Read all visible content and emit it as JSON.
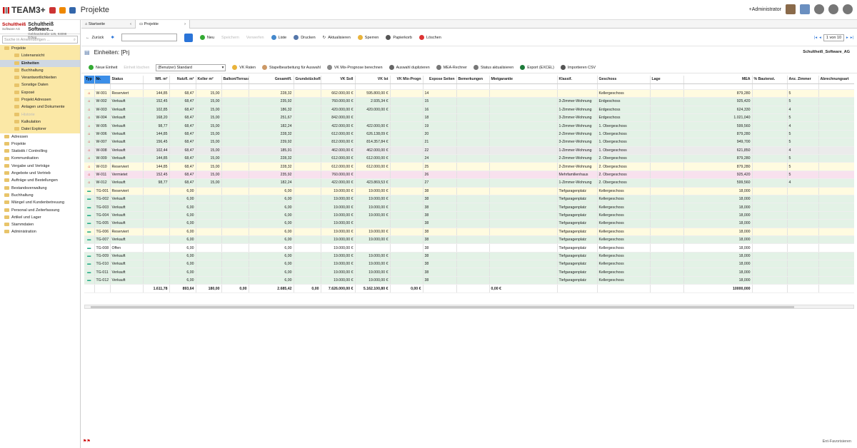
{
  "app": {
    "logo": "TEAM3+",
    "title": "Projekte"
  },
  "topbar": {
    "user": "+Administrator"
  },
  "company": {
    "brand": "Schultheiß",
    "brand_sub": "Software AG",
    "name": "Schultheiß Software...",
    "address": "Gebhardstraße 125, 93098 Erbeg..."
  },
  "search": {
    "placeholder": "Suche in Anwendungen ..."
  },
  "tree": {
    "root": "Projekte",
    "sub": [
      "Listenansicht",
      "Einheiten",
      "Buchhaltung",
      "Verantwortlichkeiten",
      "Sonstige Daten",
      "Exposé",
      "Projekt Adressen",
      "Anlagen und Dokumente",
      "Historie",
      "Kalkulation",
      "Datei Explorer"
    ],
    "modules": [
      "Adressen",
      "Projekte",
      "Statistik / Controlling",
      "Kommunikation",
      "Vergabe und Verträge",
      "Angebote und Vertrieb",
      "Aufträge und Bestellungen",
      "Bestandsverwaltung",
      "Buchhaltung",
      "Mängel und Kundenbetreuung",
      "Personal und Zeiterfassung",
      "Artikel und Lager",
      "Stammdaten",
      "Administration"
    ]
  },
  "tabs": [
    "Startseite",
    "Projekte"
  ],
  "toolbar": {
    "back": "Zurück",
    "new": "Neu",
    "save": "Speichern",
    "discard": "Verwerfen",
    "list": "Liste",
    "print": "Drucken",
    "refresh": "Aktualisieren",
    "lock": "Sperren",
    "trash": "Papierkorb",
    "delete": "Löschen",
    "pager": "1 von 10"
  },
  "section": {
    "title": "Einheiten: [Prj",
    "owner": "Schultheiß_Software_AG"
  },
  "toolbar2": {
    "new_unit": "Neue Einheit",
    "unit_delete": "Einheit löschen",
    "view": "(Benutzer) Standard",
    "vk_rates": "VK Raten",
    "batch": "Stapelbearbeitung für Auswahl",
    "vk_mix": "VK Mix-Prognose berechnen",
    "dup": "Auswahl duplizieren",
    "mea": "MEA-Rechner",
    "status": "Status aktualisieren",
    "export": "Export (EXCEL)",
    "import": "Importieren CSV"
  },
  "columns": [
    "Typ",
    "Nr.",
    "Status",
    "Wfl. m²",
    "Nutzfl. m²",
    "Keller m²",
    "Balkon/Terrasse m²",
    "Gesamtfl.",
    "Grundstücksfl.",
    "VK Soll",
    "VK Ist",
    "VK Mix-Progn",
    "Expose Seiten",
    "Bemerkungen",
    "Mietgarantie",
    "Klassif.",
    "Geschoss",
    "Lage",
    "MEA",
    "% Bautenst.",
    "Anz. Zimmer",
    "Abrechnungsart"
  ],
  "rows": [
    [
      "W-001",
      "Reserviert",
      "144,85",
      "68,47",
      "15,00",
      "",
      "228,32",
      "",
      "662.000,00 €",
      "595.800,00 €",
      "",
      "14",
      "",
      "",
      "",
      "Kellergeschoss",
      "",
      "879,280",
      "",
      "5",
      "",
      "re"
    ],
    [
      "W-002",
      "Verkauft",
      "152,45",
      "68,47",
      "15,00",
      "",
      "235,92",
      "",
      "760.000,00 €",
      "2.935,34 €",
      "",
      "15",
      "",
      "",
      "3-Zimmer-Wohnung",
      "Erdgeschoss",
      "",
      "925,420",
      "",
      "5",
      "",
      "v"
    ],
    [
      "W-003",
      "Verkauft",
      "102,85",
      "68,47",
      "15,00",
      "",
      "186,32",
      "",
      "420.000,00 €",
      "420.000,00 €",
      "",
      "16",
      "",
      "",
      "1-Zimmer-Wohnung",
      "Erdgeschoss",
      "",
      "624,330",
      "",
      "4",
      "",
      "v"
    ],
    [
      "W-004",
      "Verkauft",
      "168,20",
      "68,47",
      "15,00",
      "",
      "251,67",
      "",
      "842.000,00 €",
      "",
      "",
      "18",
      "",
      "",
      "3-Zimmer-Wohnung",
      "Erdgeschoss",
      "",
      "1.021,040",
      "",
      "5",
      "",
      "v"
    ],
    [
      "W-005",
      "Verkauft",
      "98,77",
      "68,47",
      "15,00",
      "",
      "182,24",
      "",
      "422.000,00 €",
      "422.000,00 €",
      "",
      "19",
      "",
      "",
      "1-Zimmer-Wohnung",
      "1. Obergeschoss",
      "",
      "599,560",
      "",
      "4",
      "",
      "v"
    ],
    [
      "W-006",
      "Verkauft",
      "144,85",
      "68,47",
      "15,00",
      "",
      "228,32",
      "",
      "612.000,00 €",
      "626.138,09 €",
      "",
      "20",
      "",
      "",
      "2-Zimmer-Wohnung",
      "1. Obergeschoss",
      "",
      "879,280",
      "",
      "5",
      "",
      "v"
    ],
    [
      "W-007",
      "Verkauft",
      "156,45",
      "68,47",
      "15,00",
      "",
      "239,92",
      "",
      "812.000,00 €",
      "814.357,84 €",
      "",
      "21",
      "",
      "",
      "3-Zimmer-Wohnung",
      "1. Obergeschoss",
      "",
      "949,700",
      "",
      "5",
      "",
      "v"
    ],
    [
      "W-008",
      "Verkauft",
      "102,44",
      "68,47",
      "15,00",
      "",
      "185,91",
      "",
      "462.000,00 €",
      "462.000,00 €",
      "",
      "22",
      "",
      "",
      "1-Zimmer-Wohnung",
      "1. Obergeschoss",
      "",
      "621,850",
      "",
      "4",
      "",
      "sel"
    ],
    [
      "W-009",
      "Verkauft",
      "144,85",
      "68,47",
      "15,00",
      "",
      "228,32",
      "",
      "612.000,00 €",
      "612.000,00 €",
      "",
      "24",
      "",
      "",
      "2-Zimmer-Wohnung",
      "2. Obergeschoss",
      "",
      "879,280",
      "",
      "5",
      "",
      "v"
    ],
    [
      "W-010",
      "Reserviert",
      "144,85",
      "68,47",
      "15,00",
      "",
      "228,32",
      "",
      "612.000,00 €",
      "612.000,00 €",
      "",
      "25",
      "",
      "",
      "2-Zimmer-Wohnung",
      "2. Obergeschoss",
      "",
      "879,280",
      "",
      "5",
      "",
      "re"
    ],
    [
      "W-011",
      "Vermietet",
      "152,45",
      "68,47",
      "15,00",
      "",
      "235,92",
      "",
      "760.000,00 €",
      "",
      "",
      "26",
      "",
      "",
      "Mehrfamilienhaus",
      "2. Obergeschoss",
      "",
      "925,420",
      "",
      "5",
      "",
      "vm"
    ],
    [
      "W-012",
      "Verkauft",
      "98,77",
      "68,47",
      "15,00",
      "",
      "182,24",
      "",
      "422.000,00 €",
      "423.869,53 €",
      "",
      "27",
      "",
      "",
      "1-Zimmer-Wohnung",
      "2. Obergeschoss",
      "",
      "599,560",
      "",
      "4",
      "",
      "v"
    ],
    [
      "TG-001",
      "Reserviert",
      "",
      "6,00",
      "",
      "",
      "6,00",
      "",
      "19.000,00 €",
      "19.000,00 €",
      "",
      "38",
      "",
      "",
      "Tiefgaragenplatz",
      "Kellergeschoss",
      "",
      "18,000",
      "",
      "",
      "",
      "re"
    ],
    [
      "TG-002",
      "Verkauft",
      "",
      "6,00",
      "",
      "",
      "6,00",
      "",
      "19.000,00 €",
      "19.000,00 €",
      "",
      "38",
      "",
      "",
      "Tiefgaragenplatz",
      "Kellergeschoss",
      "",
      "18,000",
      "",
      "",
      "",
      "v"
    ],
    [
      "TG-003",
      "Verkauft",
      "",
      "6,00",
      "",
      "",
      "6,00",
      "",
      "19.000,00 €",
      "19.000,00 €",
      "",
      "38",
      "",
      "",
      "Tiefgaragenplatz",
      "Kellergeschoss",
      "",
      "18,000",
      "",
      "",
      "",
      "v"
    ],
    [
      "TG-004",
      "Verkauft",
      "",
      "6,00",
      "",
      "",
      "6,00",
      "",
      "19.000,00 €",
      "19.000,00 €",
      "",
      "38",
      "",
      "",
      "Tiefgaragenplatz",
      "Kellergeschoss",
      "",
      "18,000",
      "",
      "",
      "",
      "v"
    ],
    [
      "TG-005",
      "Verkauft",
      "",
      "6,00",
      "",
      "",
      "6,00",
      "",
      "19.000,00 €",
      "",
      "",
      "38",
      "",
      "",
      "Tiefgaragenplatz",
      "Kellergeschoss",
      "",
      "18,000",
      "",
      "",
      "",
      "v"
    ],
    [
      "TG-006",
      "Reserviert",
      "",
      "6,00",
      "",
      "",
      "6,00",
      "",
      "19.000,00 €",
      "19.000,00 €",
      "",
      "38",
      "",
      "",
      "Tiefgaragenplatz",
      "Kellergeschoss",
      "",
      "18,000",
      "",
      "",
      "",
      "re"
    ],
    [
      "TG-007",
      "Verkauft",
      "",
      "6,00",
      "",
      "",
      "6,00",
      "",
      "19.000,00 €",
      "19.000,00 €",
      "",
      "38",
      "",
      "",
      "Tiefgaragenplatz",
      "Kellergeschoss",
      "",
      "18,000",
      "",
      "",
      "",
      "v"
    ],
    [
      "TG-008",
      "Offen",
      "",
      "6,00",
      "",
      "",
      "6,00",
      "",
      "19.000,00 €",
      "",
      "",
      "38",
      "",
      "",
      "Tiefgaragenplatz",
      "Kellergeschoss",
      "",
      "18,000",
      "",
      "",
      "",
      "of"
    ],
    [
      "TG-009",
      "Verkauft",
      "",
      "6,00",
      "",
      "",
      "6,00",
      "",
      "19.000,00 €",
      "19.000,00 €",
      "",
      "38",
      "",
      "",
      "Tiefgaragenplatz",
      "Kellergeschoss",
      "",
      "18,000",
      "",
      "",
      "",
      "v"
    ],
    [
      "TG-010",
      "Verkauft",
      "",
      "6,00",
      "",
      "",
      "6,00",
      "",
      "19.000,00 €",
      "19.000,00 €",
      "",
      "38",
      "",
      "",
      "Tiefgaragenplatz",
      "Kellergeschoss",
      "",
      "18,000",
      "",
      "",
      "",
      "v"
    ],
    [
      "TG-011",
      "Verkauft",
      "",
      "6,00",
      "",
      "",
      "6,00",
      "",
      "19.000,00 €",
      "19.000,00 €",
      "",
      "38",
      "",
      "",
      "Tiefgaragenplatz",
      "Kellergeschoss",
      "",
      "18,000",
      "",
      "",
      "",
      "v"
    ],
    [
      "TG-012",
      "Verkauft",
      "",
      "6,00",
      "",
      "",
      "6,00",
      "",
      "19.000,00 €",
      "19.000,00 €",
      "",
      "38",
      "",
      "",
      "Tiefgaragenplatz",
      "Kellergeschoss",
      "",
      "18,000",
      "",
      "",
      "",
      "v"
    ]
  ],
  "sums": {
    "wfl": "1.611,78",
    "nutzfl": "893,64",
    "keller": "180,00",
    "balkon": "0,00",
    "gesamt": "2.685,42",
    "grund": "0,00",
    "vksoll": "7.626.000,00 €",
    "vkist": "5.162.100,80 €",
    "mix": "0,00 €",
    "miet": "0,00 €",
    "mea": "10000,000"
  },
  "footer": {
    "text": "Ent-Favorisieren"
  },
  "colors": {
    "verkauft": "#e3f2e6",
    "reserviert": "#fffbe0",
    "vermietet": "#f8e1ee",
    "accent": "#3b8ee8"
  }
}
